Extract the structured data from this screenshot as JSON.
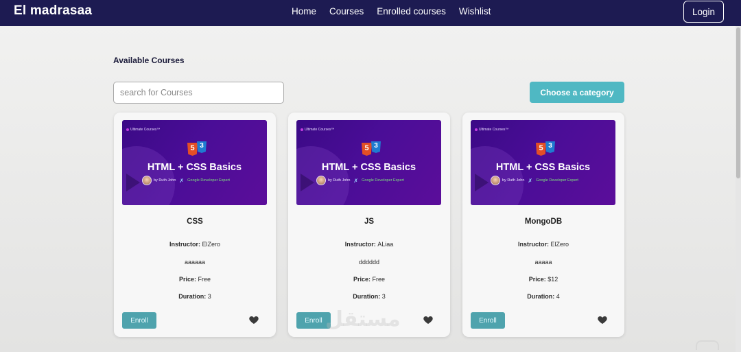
{
  "nav": {
    "brand": "El madrasaa",
    "links": [
      "Home",
      "Courses",
      "Enrolled courses",
      "Wishlist"
    ],
    "login_label": "Login"
  },
  "main": {
    "title": "Available Courses",
    "search_placeholder": "search for Courses",
    "category_button": "Choose a category"
  },
  "thumbnail": {
    "brand": "Ultimate Courses™",
    "title": "HTML + CSS Basics",
    "author": "by Ruth John",
    "badge": "Google Developer Expert",
    "html_num": "5",
    "css_num": "3"
  },
  "labels": {
    "instructor": "Instructor:",
    "price": "Price:",
    "duration": "Duration:",
    "enroll": "Enroll"
  },
  "courses": [
    {
      "name": "CSS",
      "instructor": "ElZero",
      "description": "aaaaaa",
      "price": "Free",
      "duration": "3"
    },
    {
      "name": "JS",
      "instructor": "ALiaa",
      "description": "dddddd",
      "price": "Free",
      "duration": "3"
    },
    {
      "name": "MongoDB",
      "instructor": "ElZero",
      "description": "aaaaa",
      "price": "$12",
      "duration": "4"
    }
  ],
  "colors": {
    "navbar": "#1d1b52",
    "accent": "#4fb8c3",
    "enroll": "#4fa3ad",
    "thumbnail": "#4a0d97"
  }
}
